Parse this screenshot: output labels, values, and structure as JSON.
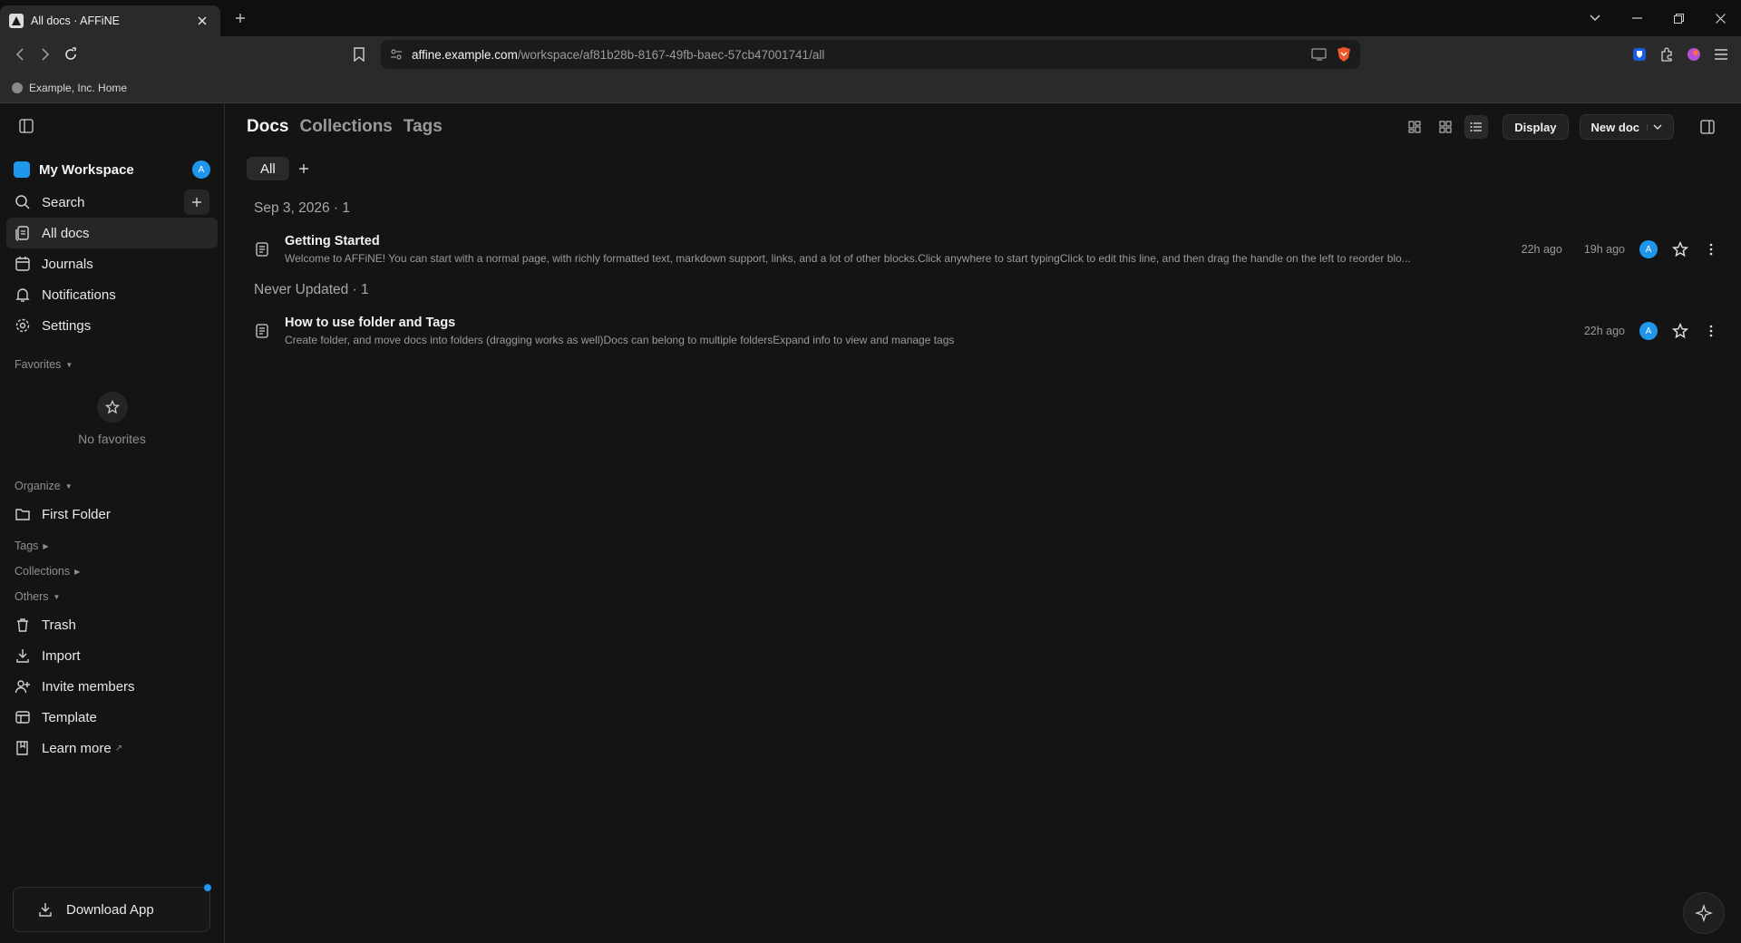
{
  "browser": {
    "tab_title": "All docs · AFFiNE",
    "url_host": "affine.example.com",
    "url_path": "/workspace/af81b28b-8167-49fb-baec-57cb47001741/all",
    "bookmark_label": "Example, Inc. Home"
  },
  "sidebar": {
    "workspace_name": "My Workspace",
    "avatar_letter": "A",
    "search_label": "Search",
    "nav": [
      {
        "label": "All docs",
        "icon": "all-docs-icon"
      },
      {
        "label": "Journals",
        "icon": "calendar-icon"
      },
      {
        "label": "Notifications",
        "icon": "bell-icon"
      },
      {
        "label": "Settings",
        "icon": "gear-icon"
      }
    ],
    "favorites_title": "Favorites",
    "no_favorites": "No favorites",
    "organize_title": "Organize",
    "folder_label": "First Folder",
    "tags_title": "Tags",
    "collections_title": "Collections",
    "others_title": "Others",
    "others": [
      {
        "label": "Trash",
        "icon": "trash-icon"
      },
      {
        "label": "Import",
        "icon": "import-icon"
      },
      {
        "label": "Invite members",
        "icon": "invite-icon"
      },
      {
        "label": "Template",
        "icon": "template-icon"
      },
      {
        "label": "Learn more",
        "icon": "book-icon",
        "suffix": "↗"
      }
    ],
    "download_label": "Download App"
  },
  "main": {
    "tabs": [
      "Docs",
      "Collections",
      "Tags"
    ],
    "display_label": "Display",
    "new_doc_label": "New doc",
    "filter_all": "All",
    "groups": [
      {
        "title": "Sep 3, 2026 · 1",
        "docs": [
          {
            "title": "Getting Started",
            "preview": "Welcome to AFFiNE! You can start with a normal page, with richly formatted text, markdown support, links, and a lot of other blocks.Click anywhere to start typingClick to edit this line, and then drag the handle on the left to reorder blo...",
            "created": "22h ago",
            "updated": "19h ago",
            "avatar": "A"
          }
        ]
      },
      {
        "title": "Never Updated · 1",
        "docs": [
          {
            "title": "How to use folder and Tags",
            "preview": "Create folder, and move docs into folders (dragging works as well)Docs can belong to multiple foldersExpand info to view and manage tags",
            "created": "22h ago",
            "avatar": "A"
          }
        ]
      }
    ]
  }
}
